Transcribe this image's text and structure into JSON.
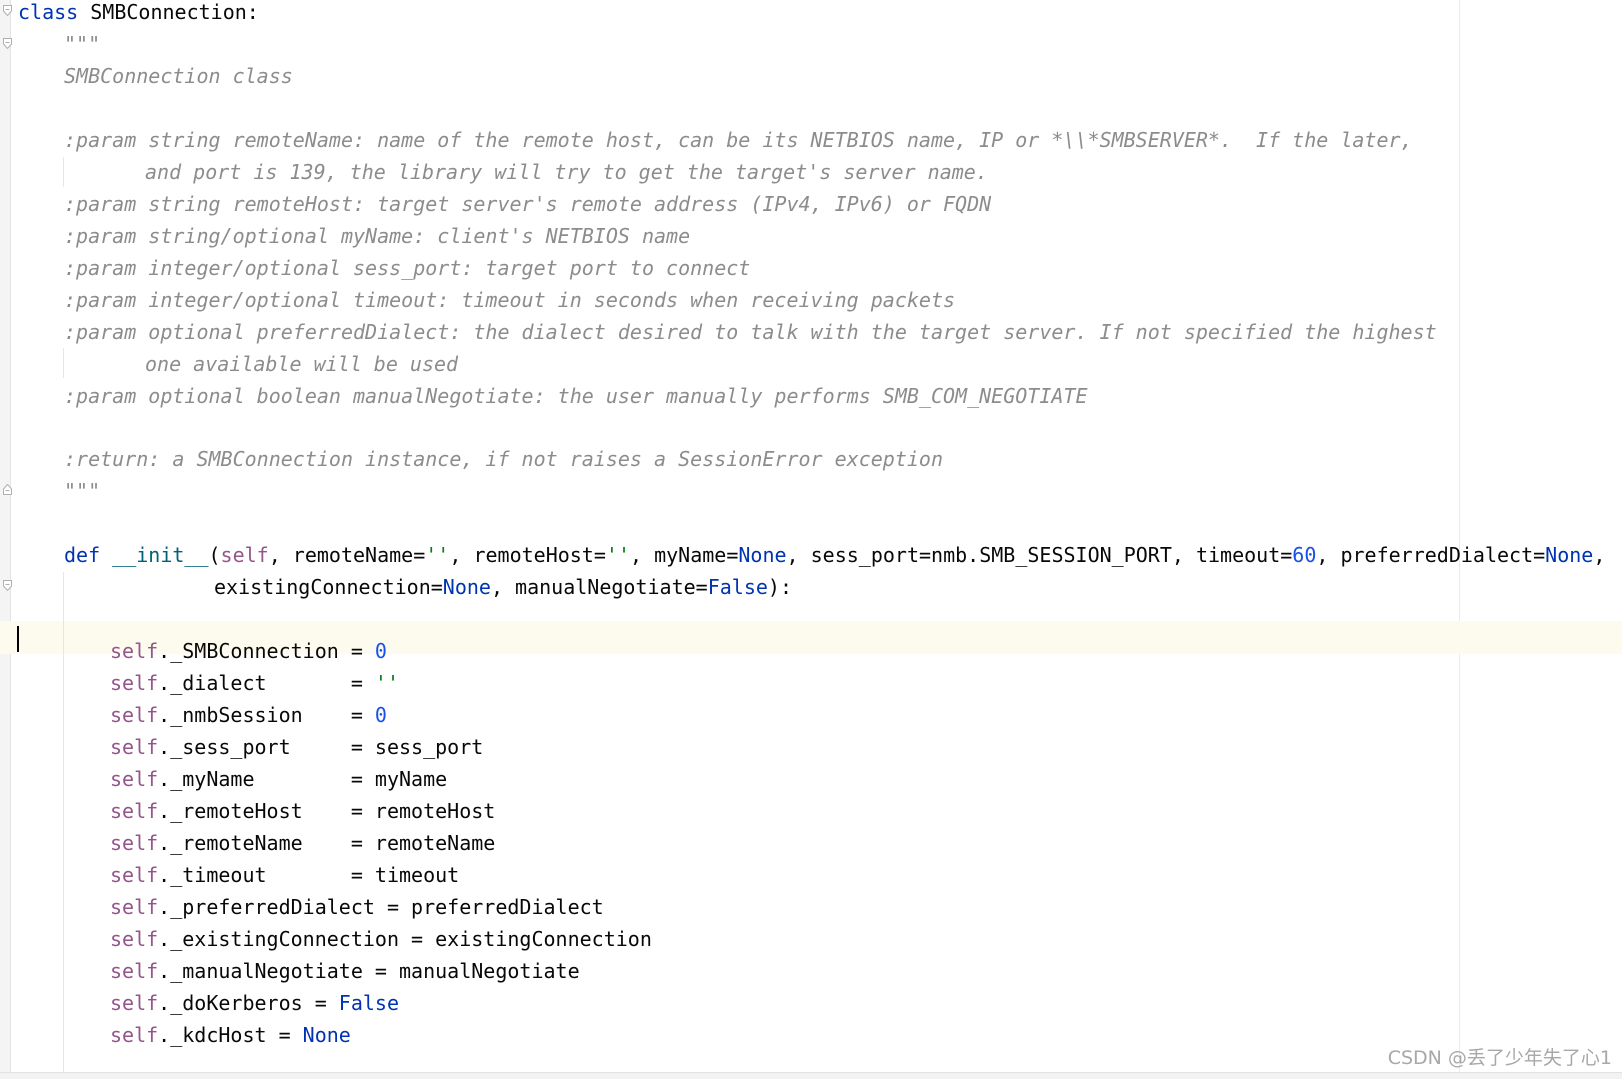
{
  "code": {
    "class_kw": "class",
    "class_name": "SMBConnection:",
    "doc_quotes": "\"\"\"",
    "doc": {
      "title": "SMBConnection class",
      "p1": ":param string remoteName: name of the remote host, can be its NETBIOS name, IP or *\\\\*SMBSERVER*.  If the later,",
      "p1b": "and port is 139, the library will try to get the target's server name.",
      "p2": ":param string remoteHost: target server's remote address (IPv4, IPv6) or FQDN",
      "p3": ":param string/optional myName: client's NETBIOS name",
      "p4": ":param integer/optional sess_port: target port to connect",
      "p5": ":param integer/optional timeout: timeout in seconds when receiving packets",
      "p6": ":param optional preferredDialect: the dialect desired to talk with the target server. If not specified the highest",
      "p6b": "one available will be used",
      "p7": ":param optional boolean manualNegotiate: the user manually performs SMB_COM_NEGOTIATE",
      "ret": ":return: a SMBConnection instance, if not raises a SessionError exception"
    },
    "def_kw": "def",
    "init_name": "__init__",
    "self_kw": "self",
    "empty_str": "''",
    "none_kw": "None",
    "false_kw": "False",
    "zero": "0",
    "sixty": "60",
    "sig": {
      "open_paren": "(",
      "sep1": ", remoteName=",
      "sep2": ", remoteHost=",
      "sep3": ", myName=",
      "sep4": ", sess_port=nmb.SMB_SESSION_PORT, timeout=",
      "sep5": ", preferredDialect=",
      "trail": ",",
      "cont_a": "existingConnection=",
      "cont_b": ", manualNegotiate=",
      "cont_end": "):"
    },
    "assign": {
      "smbconn": "._SMBConnection = ",
      "dialect": "._dialect       = ",
      "nmb": "._nmbSession    = ",
      "sess_port": "._sess_port     = sess_port",
      "myname": "._myName        = myName",
      "rhost": "._remoteHost    = remoteHost",
      "rname": "._remoteName    = remoteName",
      "timeout": "._timeout       = timeout",
      "pref": "._preferredDialect = preferredDialect",
      "exist": "._existingConnection = existingConnection",
      "manual": "._manualNegotiate = manualNegotiate",
      "kerb": "._doKerberos = ",
      "kdc": "._kdcHost = "
    }
  },
  "watermark": "CSDN @丢了少年失了心1"
}
